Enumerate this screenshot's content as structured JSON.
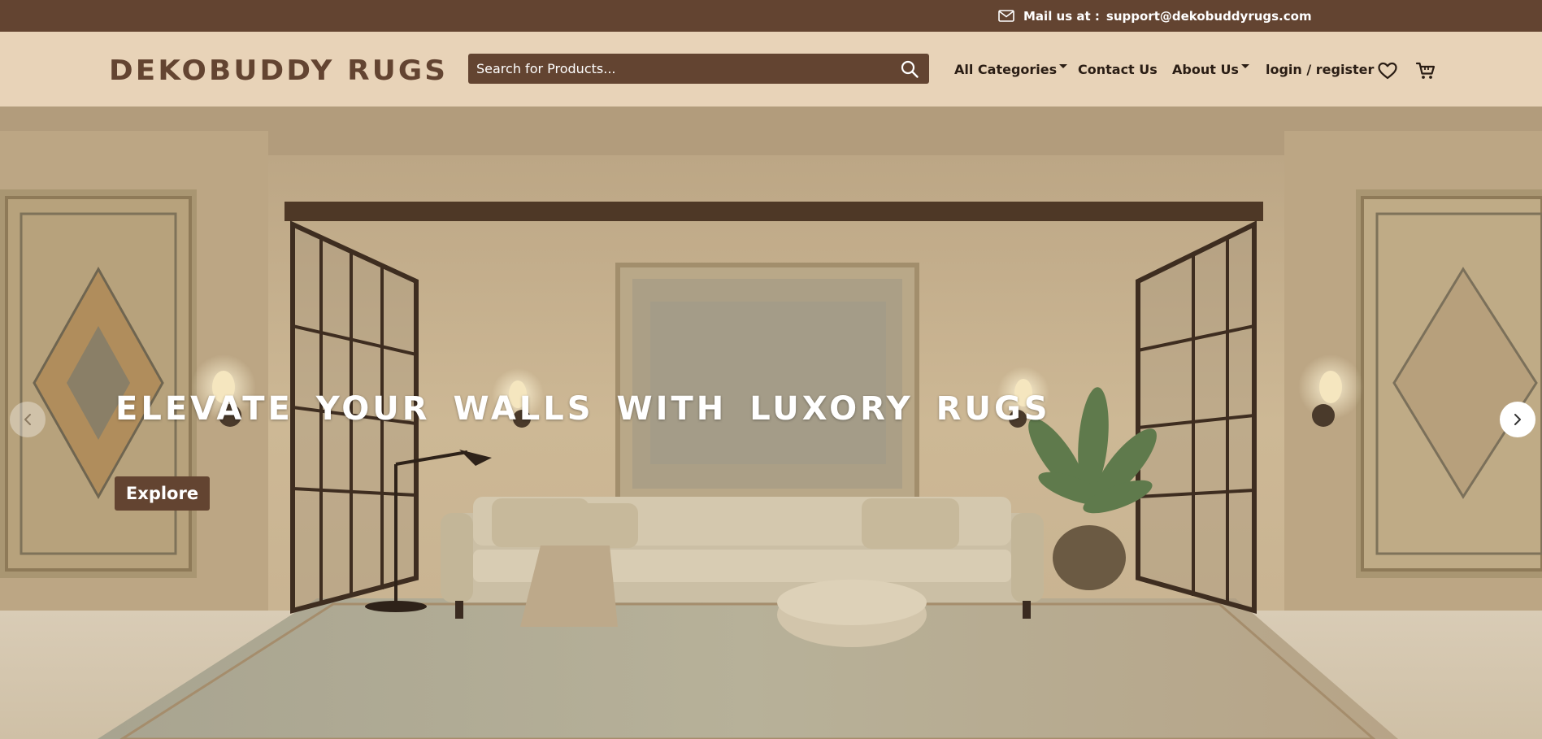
{
  "topbar": {
    "mail_icon": "envelope-icon",
    "mail_label": "Mail us at :",
    "email": "support@dekobuddyrugs.com"
  },
  "header": {
    "logo": "DEKOBUDDY RUGS",
    "search_placeholder": "Search for Products...",
    "search_icon": "search-icon",
    "nav": {
      "categories": "All Categories",
      "contact": "Contact Us",
      "about": "About Us",
      "login": "login / register"
    },
    "wishlist_icon": "heart-icon",
    "cart_icon": "cart-icon"
  },
  "hero": {
    "title": "ELEVATE YOUR WALLS WITH LUXORY RUGS",
    "cta": "Explore",
    "prev_icon": "chevron-left-icon",
    "next_icon": "chevron-right-icon"
  },
  "colors": {
    "brand_brown": "#634431",
    "header_beige": "#e8d3b8",
    "white": "#ffffff"
  }
}
